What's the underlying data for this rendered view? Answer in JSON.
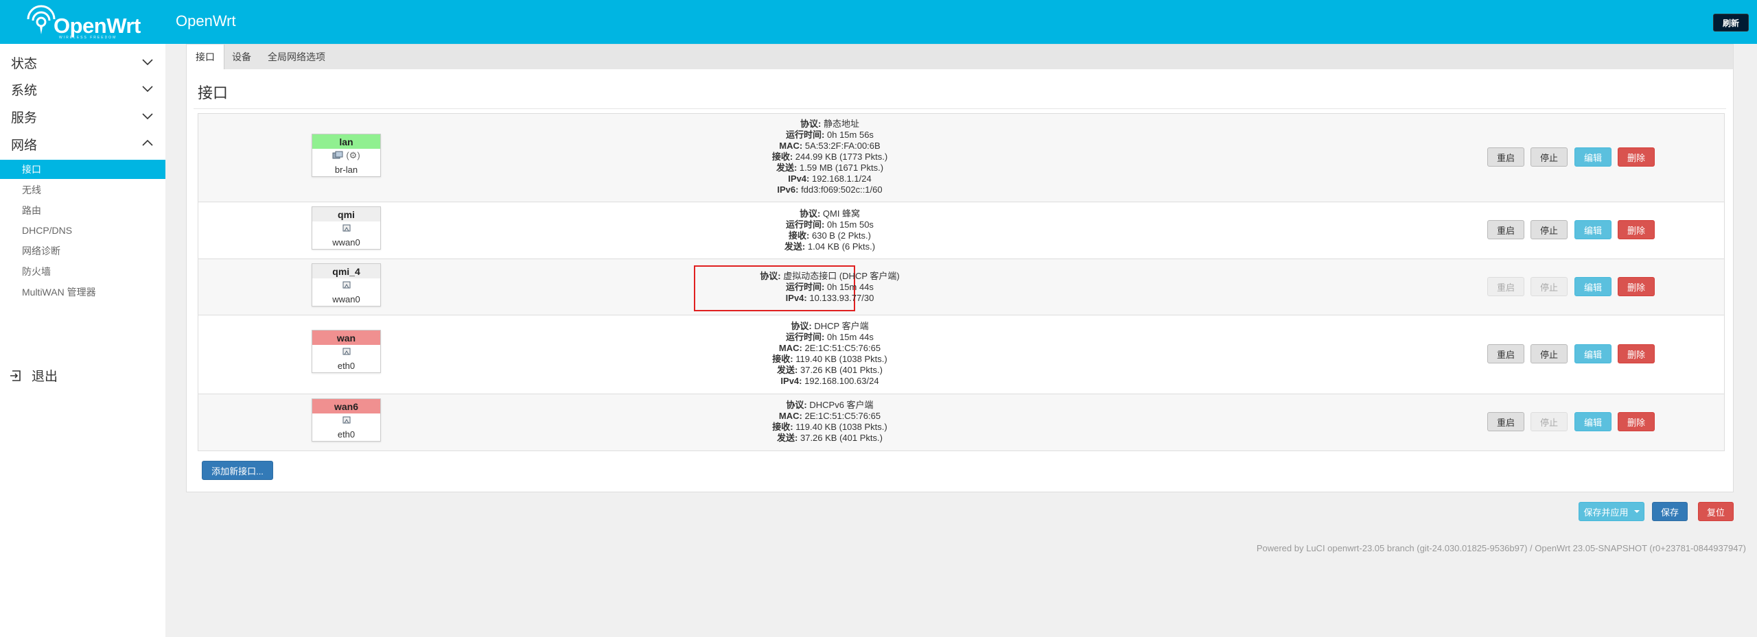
{
  "header": {
    "logo_text": "OpenWrt",
    "logo_subtext": "WIRELESS FREEDOM",
    "brand": "OpenWrt",
    "refresh_label": "刷新"
  },
  "sidebar": {
    "categories": [
      {
        "label": "状态",
        "expanded": false
      },
      {
        "label": "系统",
        "expanded": false
      },
      {
        "label": "服务",
        "expanded": false
      },
      {
        "label": "网络",
        "expanded": true
      }
    ],
    "network_items": [
      "接口",
      "无线",
      "路由",
      "DHCP/DNS",
      "网络诊断",
      "防火墙",
      "MultiWAN 管理器"
    ],
    "active_item": "接口",
    "logout_label": "退出"
  },
  "tabs": [
    "接口",
    "设备",
    "全局网络选项"
  ],
  "section_title": "接口",
  "interfaces": [
    {
      "name": "lan",
      "device": "br-lan",
      "color": "#90f090",
      "lines": [
        [
          "协议:",
          " 静态地址"
        ],
        [
          "运行时间:",
          " 0h 15m 56s"
        ],
        [
          "MAC:",
          " 5A:53:2F:FA:00:6B"
        ],
        [
          "接收:",
          " 244.99 KB (1773 Pkts.)"
        ],
        [
          "发送:",
          " 1.59 MB (1671 Pkts.)"
        ],
        [
          "IPv4:",
          " 192.168.1.1/24"
        ],
        [
          "IPv6:",
          " fdd3:f069:502c::1/60"
        ]
      ],
      "icon_text": "(⚙)"
    },
    {
      "name": "qmi",
      "device": "wwan0",
      "color": "#eeeeee",
      "lines": [
        [
          "协议:",
          " QMI 蜂窝"
        ],
        [
          "运行时间:",
          " 0h 15m 50s"
        ],
        [
          "接收:",
          " 630 B (2 Pkts.)"
        ],
        [
          "发送:",
          " 1.04 KB (6 Pkts.)"
        ]
      ]
    },
    {
      "name": "qmi_4",
      "device": "wwan0",
      "color": "#eeeeee",
      "lines": [
        [
          "协议:",
          " 虚拟动态接口 (DHCP 客户端)"
        ],
        [
          "运行时间:",
          " 0h 15m 44s"
        ],
        [
          "IPv4:",
          " 10.133.93.77/30"
        ]
      ]
    },
    {
      "name": "wan",
      "device": "eth0",
      "color": "#f09090",
      "lines": [
        [
          "协议:",
          " DHCP 客户端"
        ],
        [
          "运行时间:",
          " 0h 15m 44s"
        ],
        [
          "MAC:",
          " 2E:1C:51:C5:76:65"
        ],
        [
          "接收:",
          " 119.40 KB (1038 Pkts.)"
        ],
        [
          "发送:",
          " 37.26 KB (401 Pkts.)"
        ],
        [
          "IPv4:",
          " 192.168.100.63/24"
        ]
      ]
    },
    {
      "name": "wan6",
      "device": "eth0",
      "color": "#f09090",
      "lines": [
        [
          "协议:",
          " DHCPv6 客户端"
        ],
        [
          "MAC:",
          " 2E:1C:51:C5:76:65"
        ],
        [
          "接收:",
          " 119.40 KB (1038 Pkts.)"
        ],
        [
          "发送:",
          " 37.26 KB (401 Pkts.)"
        ]
      ]
    }
  ],
  "row_buttons": {
    "restart": "重启",
    "stop": "停止",
    "edit": "编辑",
    "delete": "删除"
  },
  "add_interface_label": "添加新接口...",
  "actions": {
    "save_apply": "保存并应用",
    "save": "保存",
    "reset": "复位"
  },
  "footer": "Powered by LuCI openwrt-23.05 branch (git-24.030.01825-9536b97) / OpenWrt 23.05-SNAPSHOT (r0+23781-0844937947)",
  "colors": {
    "header": "#00b5e2",
    "active_menu": "#00b5e2",
    "highlight_box": "#e02020"
  }
}
